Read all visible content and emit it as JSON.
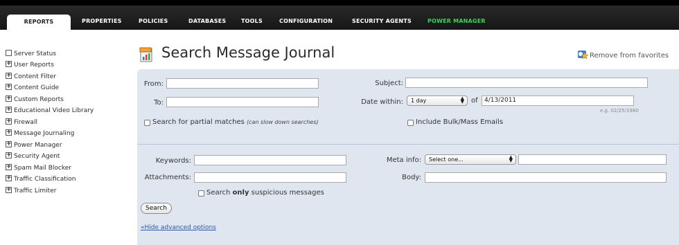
{
  "nav": {
    "tabs": [
      {
        "label": "REPORTS",
        "active": true
      },
      {
        "label": "PROPERTIES"
      },
      {
        "label": "POLICIES"
      },
      {
        "label": "DATABASES"
      },
      {
        "label": "TOOLS"
      },
      {
        "label": "CONFIGURATION"
      },
      {
        "label": "SECURITY AGENTS"
      },
      {
        "label": "POWER MANAGER"
      }
    ]
  },
  "sidebar": {
    "items": [
      {
        "label": "Server Status",
        "expandable": false
      },
      {
        "label": "User Reports",
        "expandable": true
      },
      {
        "label": "Content Filter",
        "expandable": true
      },
      {
        "label": "Content Guide",
        "expandable": true
      },
      {
        "label": "Custom Reports",
        "expandable": true
      },
      {
        "label": "Educational Video Library",
        "expandable": true
      },
      {
        "label": "Firewall",
        "expandable": true
      },
      {
        "label": "Message Journaling",
        "expandable": true
      },
      {
        "label": "Power Manager",
        "expandable": true
      },
      {
        "label": "Security Agent",
        "expandable": true
      },
      {
        "label": "Spam Mail Blocker",
        "expandable": true
      },
      {
        "label": "Traffic Classification",
        "expandable": true
      },
      {
        "label": "Traffic Limiter",
        "expandable": true
      }
    ]
  },
  "page": {
    "title": "Search Message Journal",
    "favorites_label": "Remove from favorites"
  },
  "form": {
    "from_label": "From:",
    "from_value": "",
    "to_label": "To:",
    "to_value": "",
    "subject_label": "Subject:",
    "subject_value": "",
    "date_within_label": "Date within:",
    "date_within_value": "1 day",
    "of_label": "of",
    "date_value": "4/13/2011",
    "date_hint": "e.g. 02/25/1980",
    "partial_label": "Search for partial matches",
    "partial_note": "(can slow down searches)",
    "bulk_label": "Include Bulk/Mass Emails",
    "keywords_label": "Keywords:",
    "attachments_label": "Attachments:",
    "meta_label": "Meta info:",
    "meta_value": "Select one...",
    "body_label": "Body:",
    "suspicious_pre": "Search ",
    "suspicious_bold": "only",
    "suspicious_post": " suspicious messages",
    "search_button": "Search",
    "hide_advanced": "«Hide advanced options"
  },
  "colors": {
    "nav_bg": "#1c1c1c",
    "panel_bg": "#dfe6ef",
    "power_manager": "#3bd35a",
    "link": "#3355aa"
  }
}
